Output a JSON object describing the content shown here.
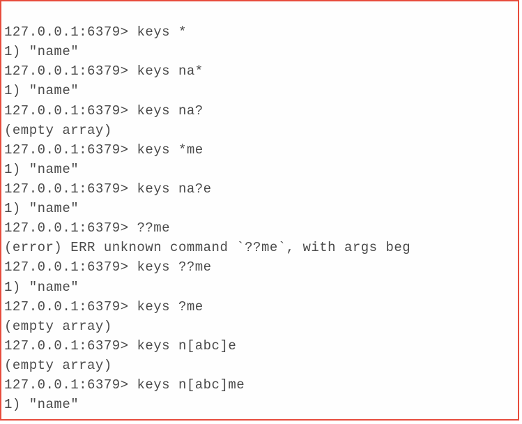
{
  "terminal": {
    "prompt": "127.0.0.1:6379> ",
    "lines": [
      {
        "type": "prompt",
        "prompt": "127.0.0.1:6379> ",
        "cmd": "keys *"
      },
      {
        "type": "output",
        "text": "1) \"name\""
      },
      {
        "type": "prompt",
        "prompt": "127.0.0.1:6379> ",
        "cmd": "keys na*"
      },
      {
        "type": "output",
        "text": "1) \"name\""
      },
      {
        "type": "prompt",
        "prompt": "127.0.0.1:6379> ",
        "cmd": "keys na?"
      },
      {
        "type": "output",
        "text": "(empty array)"
      },
      {
        "type": "prompt",
        "prompt": "127.0.0.1:6379> ",
        "cmd": "keys *me"
      },
      {
        "type": "output",
        "text": "1) \"name\""
      },
      {
        "type": "prompt",
        "prompt": "127.0.0.1:6379> ",
        "cmd": "keys na?e"
      },
      {
        "type": "output",
        "text": "1) \"name\""
      },
      {
        "type": "prompt",
        "prompt": "127.0.0.1:6379> ",
        "cmd": "??me"
      },
      {
        "type": "output",
        "text": "(error) ERR unknown command `??me`, with args beg"
      },
      {
        "type": "prompt",
        "prompt": "127.0.0.1:6379> ",
        "cmd": "keys ??me"
      },
      {
        "type": "output",
        "text": "1) \"name\""
      },
      {
        "type": "prompt",
        "prompt": "127.0.0.1:6379> ",
        "cmd": "keys ?me"
      },
      {
        "type": "output",
        "text": "(empty array)"
      },
      {
        "type": "prompt",
        "prompt": "127.0.0.1:6379> ",
        "cmd": "keys n[abc]e"
      },
      {
        "type": "output",
        "text": "(empty array)"
      },
      {
        "type": "prompt",
        "prompt": "127.0.0.1:6379> ",
        "cmd": "keys n[abc]me"
      },
      {
        "type": "output",
        "text": "1) \"name\""
      }
    ]
  }
}
